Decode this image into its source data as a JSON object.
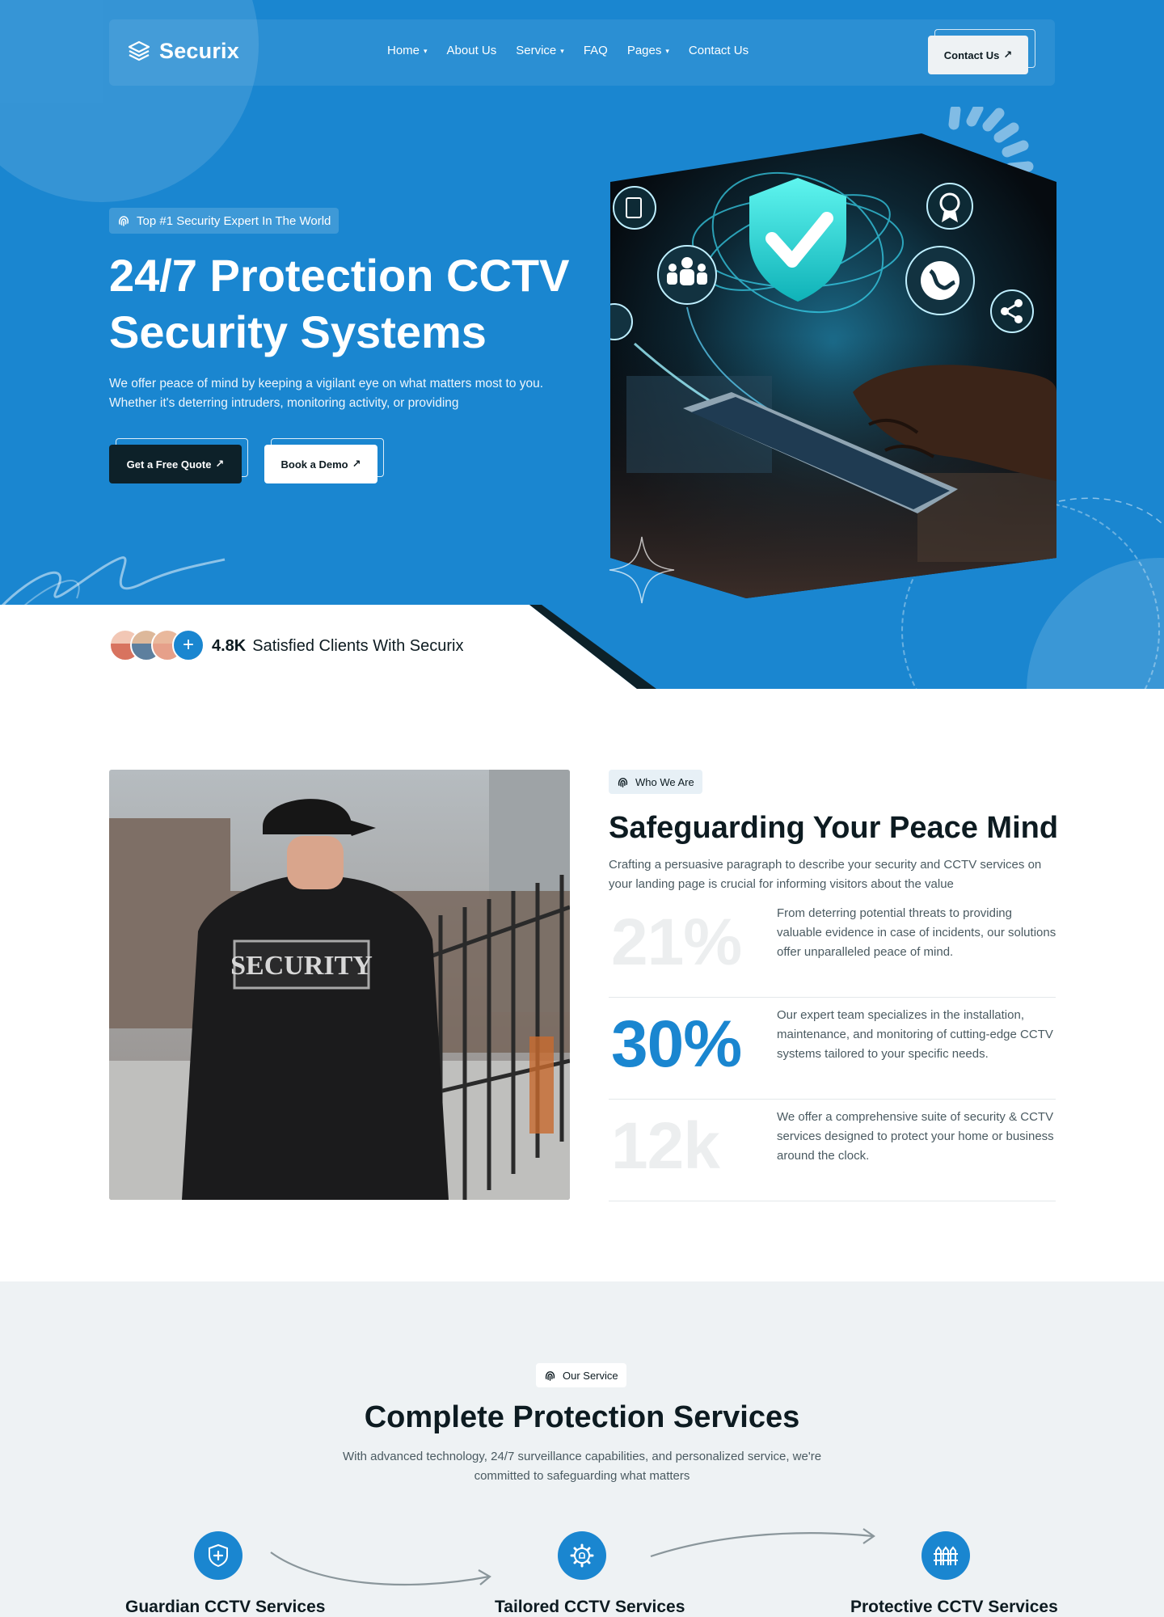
{
  "brand": {
    "name": "Securix",
    "primary_color": "#1a86d0",
    "dark_color": "#0d2129",
    "logo_icon": "stacked-layers-icon"
  },
  "nav": {
    "items": [
      {
        "label": "Home",
        "has_dropdown": true
      },
      {
        "label": "About Us",
        "has_dropdown": false
      },
      {
        "label": "Service",
        "has_dropdown": true
      },
      {
        "label": "FAQ",
        "has_dropdown": false
      },
      {
        "label": "Pages",
        "has_dropdown": true
      },
      {
        "label": "Contact Us",
        "has_dropdown": false
      }
    ],
    "cta_label": "Contact Us",
    "arrow_glyph": "↗",
    "chevron_glyph": "⌄"
  },
  "hero": {
    "badge_label": "Top #1 Security Expert In The World",
    "title_line1": "24/7 Protection CCTV",
    "title_line2": "Security Systems",
    "description": "We offer peace of mind by keeping a vigilant eye on what matters most to you. Whether it's deterring intruders, monitoring activity, or providing",
    "primary_button": "Get a Free Quote",
    "secondary_button": "Book a Demo",
    "image_icons": [
      "document-icon",
      "people-group-icon",
      "shield-check-icon",
      "award-badge-icon",
      "globe-icon",
      "share-icon",
      "gear-icon"
    ]
  },
  "clients": {
    "count": "4.8K",
    "label": "Satisfied Clients With Securix",
    "plus_glyph": "+"
  },
  "about": {
    "badge_label": "Who We Are",
    "title": "Safeguarding Your Peace Mind",
    "description": "Crafting a persuasive paragraph to describe your security and CCTV services on your landing page is crucial for informing visitors about the value",
    "image_patch_text": "SECURITY",
    "stats": [
      {
        "value": "21%",
        "text": "From deterring potential threats to providing valuable evidence in case of incidents, our solutions offer unparalleled peace of mind.",
        "highlighted": false
      },
      {
        "value": "30%",
        "text": "Our expert team specializes in the installation, maintenance, and monitoring of cutting-edge CCTV systems tailored to your specific needs.",
        "highlighted": true
      },
      {
        "value": "12k",
        "text": "We offer a comprehensive suite of security & CCTV services designed to protect your home or business around the clock.",
        "highlighted": false
      }
    ]
  },
  "services": {
    "badge_label": "Our Service",
    "title": "Complete Protection Services",
    "description": "With advanced technology, 24/7 surveillance capabilities, and personalized service, we're committed to safeguarding what matters",
    "items": [
      {
        "name": "Guardian CCTV Services",
        "icon": "shield-plus-icon"
      },
      {
        "name": "Tailored CCTV Services",
        "icon": "gear-bulb-icon"
      },
      {
        "name": "Protective CCTV Services",
        "icon": "fence-icon"
      }
    ]
  }
}
